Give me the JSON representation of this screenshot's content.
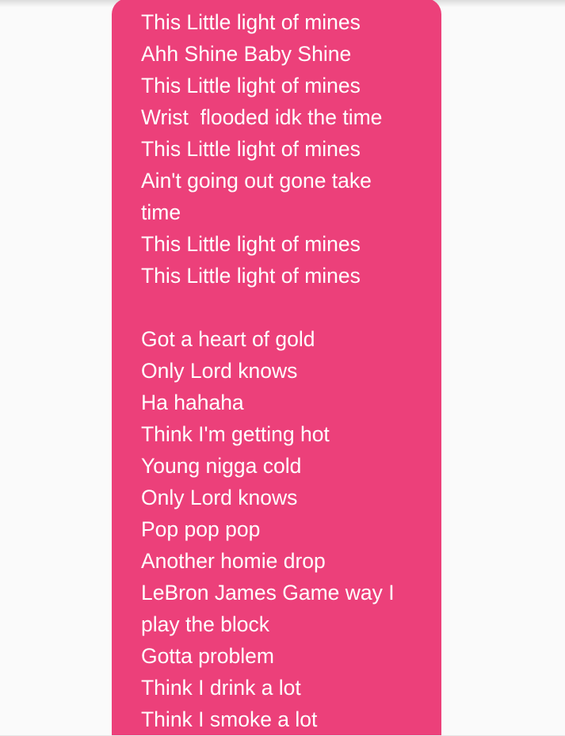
{
  "colors": {
    "background": "#fafafa",
    "bubble": "#ec407a",
    "text": "#ffffff"
  },
  "message": {
    "lines": [
      "This Little light of mines",
      "Ahh Shine Baby Shine",
      "This Little light of mines",
      "Wrist  flooded idk the time",
      "This Little light of mines",
      "Ain't going out gone take",
      "time",
      "This Little light of mines",
      "This Little light of mines",
      "",
      "Got a heart of gold",
      "Only Lord knows",
      "Ha hahaha",
      "Think I'm getting hot",
      "Young nigga cold",
      "Only Lord knows",
      "Pop pop pop",
      "Another homie drop",
      "LeBron James Game way I",
      "play the block",
      "Gotta problem",
      "Think I drink a lot",
      "Think I smoke a lot"
    ]
  }
}
